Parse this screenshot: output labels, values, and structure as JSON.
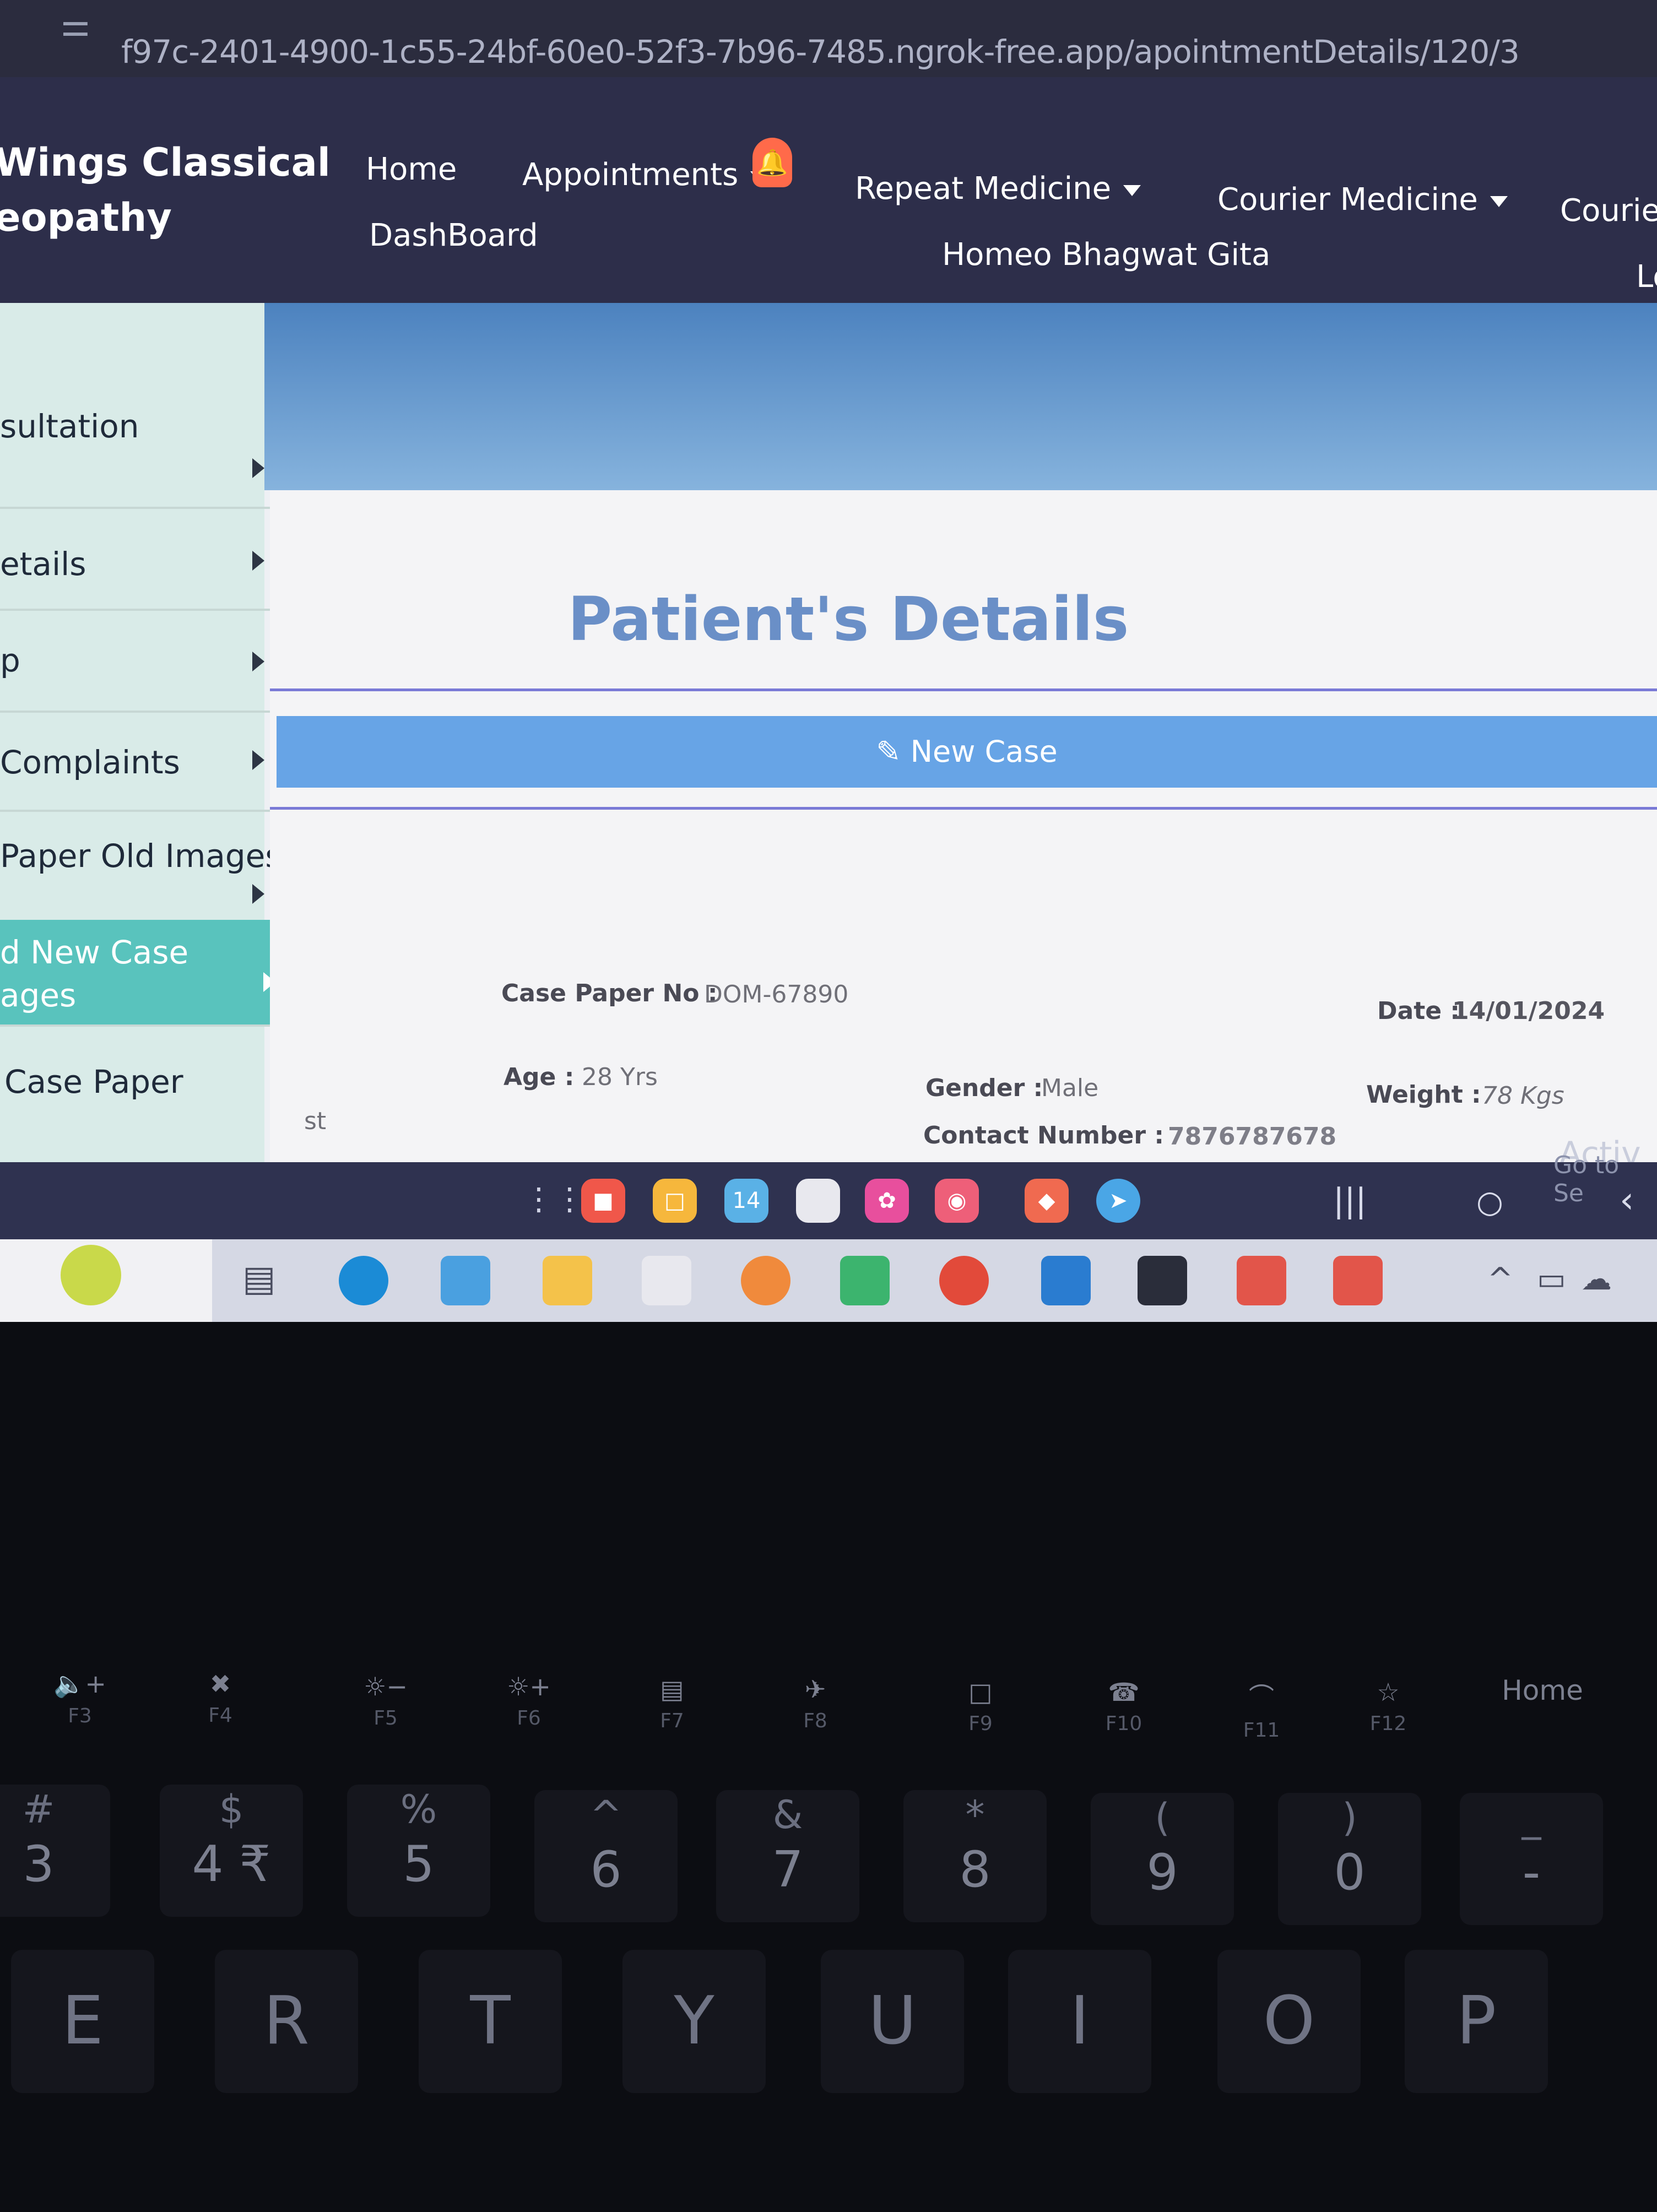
{
  "browser": {
    "url": "f97c-2401-4900-1c55-24bf-60e0-52f3-7b96-7485.ngrok-free.app/apointmentDetails/120/3"
  },
  "nav": {
    "brand_line1": "Wings Classical",
    "brand_line2": "eopathy",
    "home": "Home",
    "appointments": "Appointments",
    "repeat_medicine": "Repeat Medicine",
    "courier_medicine": "Courier Medicine",
    "courier": "Courier",
    "dashboard": "DashBoard",
    "homeo_bhagwat_gita": "Homeo Bhagwat Gita",
    "login_partial": "Lo"
  },
  "sidebar": {
    "items": [
      {
        "label": "sultation"
      },
      {
        "label": "etails"
      },
      {
        "label": "p"
      },
      {
        "label": "Complaints"
      },
      {
        "label": "Paper Old Images"
      },
      {
        "label": "d New Case\nages"
      },
      {
        "label": "Case Paper"
      }
    ]
  },
  "page": {
    "title": "Patient's Details",
    "new_case_button": "New Case",
    "stray_text": "st"
  },
  "patient": {
    "case_paper_no_label": "Case Paper No :",
    "case_paper_no": "DOM-67890",
    "date_label": "Date :",
    "date": "14/01/2024",
    "age_label": "Age :",
    "age": "28 Yrs",
    "gender_label": "Gender :",
    "gender": "Male",
    "weight_label": "Weight :",
    "weight": "78 Kgs",
    "contact_label": "Contact Number :",
    "contact": "7876787678"
  },
  "watermark": {
    "line1": "Activ",
    "line2": "Go to Se"
  },
  "appbar": {
    "calendar_day": "14"
  },
  "keyboard": {
    "fkeys": [
      {
        "icon": "🔈+",
        "label": "F3"
      },
      {
        "icon": "✖",
        "label": "F4"
      },
      {
        "icon": "☼−",
        "label": "F5"
      },
      {
        "icon": "☼+",
        "label": "F6"
      },
      {
        "icon": "▤",
        "label": "F7"
      },
      {
        "icon": "✈",
        "label": "F8"
      },
      {
        "icon": "□",
        "label": "F9"
      },
      {
        "icon": "☎",
        "label": "F10"
      },
      {
        "icon": "⌒",
        "label": "F11"
      },
      {
        "icon": "☆",
        "label": "F12"
      },
      {
        "icon": "",
        "label": "Home"
      }
    ],
    "numbers": [
      {
        "sym": "#",
        "main": "3"
      },
      {
        "sym": "$",
        "main": "4 ₹"
      },
      {
        "sym": "%",
        "main": "5"
      },
      {
        "sym": "^",
        "main": "6"
      },
      {
        "sym": "&",
        "main": "7"
      },
      {
        "sym": "*",
        "main": "8"
      },
      {
        "sym": "(",
        "main": "9"
      },
      {
        "sym": ")",
        "main": "0"
      },
      {
        "sym": "_",
        "main": "-"
      }
    ],
    "letters": [
      "E",
      "R",
      "T",
      "Y",
      "U",
      "I",
      "O",
      "P"
    ]
  }
}
